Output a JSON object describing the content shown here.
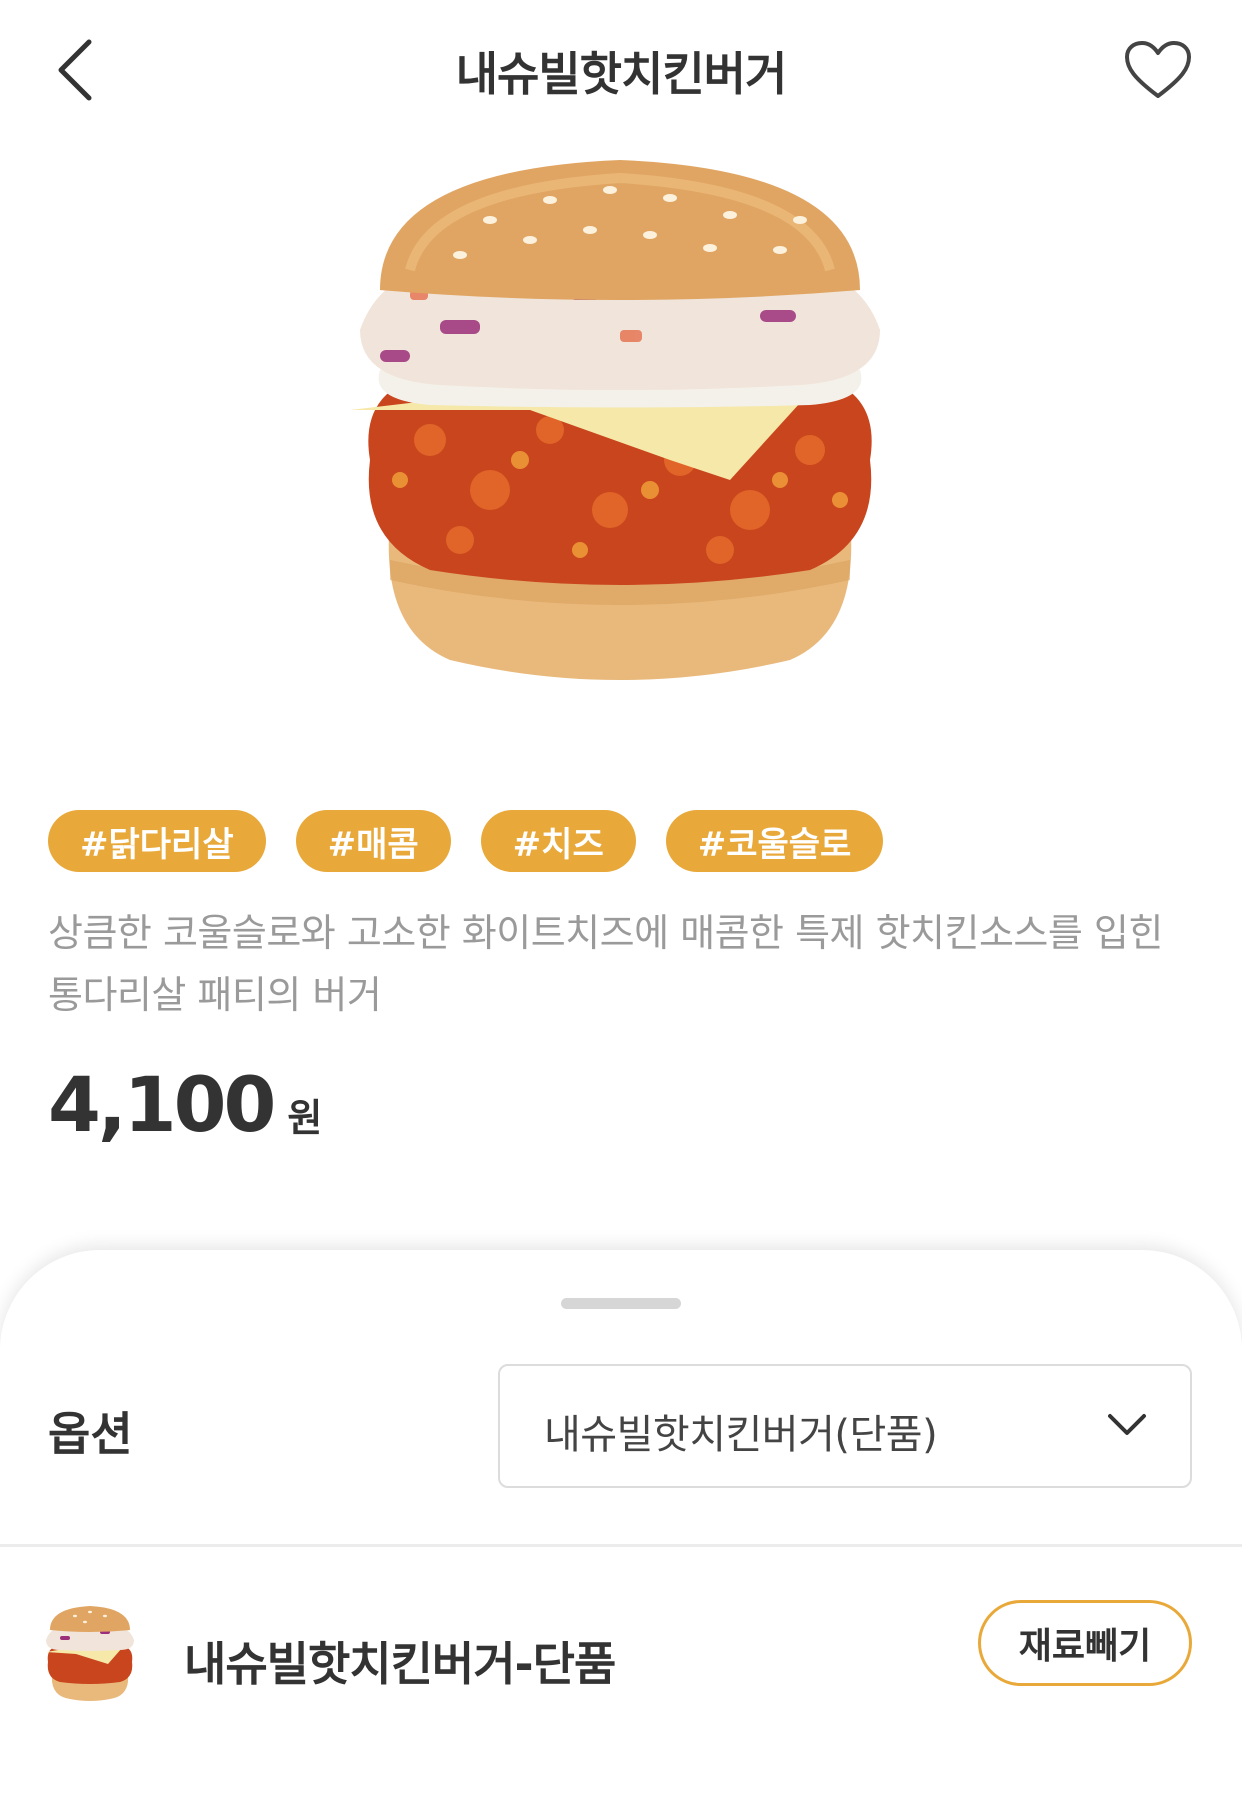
{
  "header": {
    "title": "내슈빌핫치킨버거",
    "back_icon": "chevron-left-icon",
    "favorite_icon": "heart-outline-icon"
  },
  "product": {
    "image": "burger-image",
    "tags": [
      "#닭다리살",
      "#매콤",
      "#치즈",
      "#코울슬로"
    ],
    "description": "상큼한 코울슬로와 고소한 화이트치즈에 매콤한 특제 핫치킨소스를 입힌 통다리살 패티의 버거",
    "price": "4,100",
    "price_unit": "원"
  },
  "option_sheet": {
    "label": "옵션",
    "selected_option": "내슈빌핫치킨버거(단품)",
    "dropdown_icon": "chevron-down-icon",
    "selected_item": {
      "name": "내슈빌핫치킨버거-단품",
      "remove_ingredients_label": "재료빼기"
    }
  },
  "colors": {
    "accent": "#e8a93a",
    "text_primary": "#333333",
    "text_secondary": "#9a9a9a",
    "border": "#dcdcdc"
  }
}
